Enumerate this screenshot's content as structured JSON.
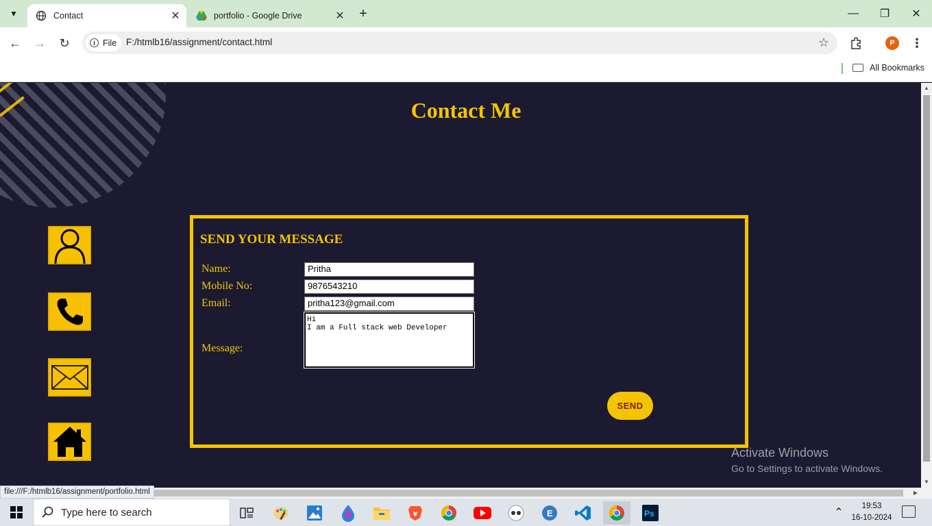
{
  "browser": {
    "tabs": [
      {
        "title": "Contact",
        "active": true
      },
      {
        "title": "portfolio - Google Drive",
        "active": false
      }
    ],
    "address": {
      "scheme_label": "File",
      "url": "F:/htmlb16/assignment/contact.html"
    },
    "bookmarks_bar": {
      "all_bookmarks": "All Bookmarks"
    },
    "profile_initial": "P",
    "status_url": "file:///F:/htmlb16/assignment/portfolio.html"
  },
  "page": {
    "title": "Contact Me",
    "form": {
      "heading": "SEND YOUR MESSAGE",
      "name_label": "Name:",
      "name_value": "Pritha",
      "mobile_label": "Mobile No:",
      "mobile_value": "9876543210",
      "email_label": "Email:",
      "email_value": "pritha123@gmail.com",
      "message_label": "Message:",
      "message_value": "Hi\nI am a Full stack web Developer",
      "send_label": "SEND"
    },
    "side_icons": [
      "person-icon",
      "phone-icon",
      "mail-icon",
      "home-icon"
    ],
    "accent_color": "#f5c400",
    "background_color": "#1c1a30"
  },
  "watermark": {
    "line1": "Activate Windows",
    "line2": "Go to Settings to activate Windows."
  },
  "taskbar": {
    "search_placeholder": "Type here to search",
    "time": "19:53",
    "date": "16-10-2024",
    "apps": [
      "task-view",
      "paint-app",
      "photos-app",
      "edge-dev",
      "file-explorer",
      "brave-browser",
      "chrome",
      "youtube",
      "media-app",
      "edge-app",
      "vscode",
      "chrome-active",
      "photoshop"
    ]
  }
}
